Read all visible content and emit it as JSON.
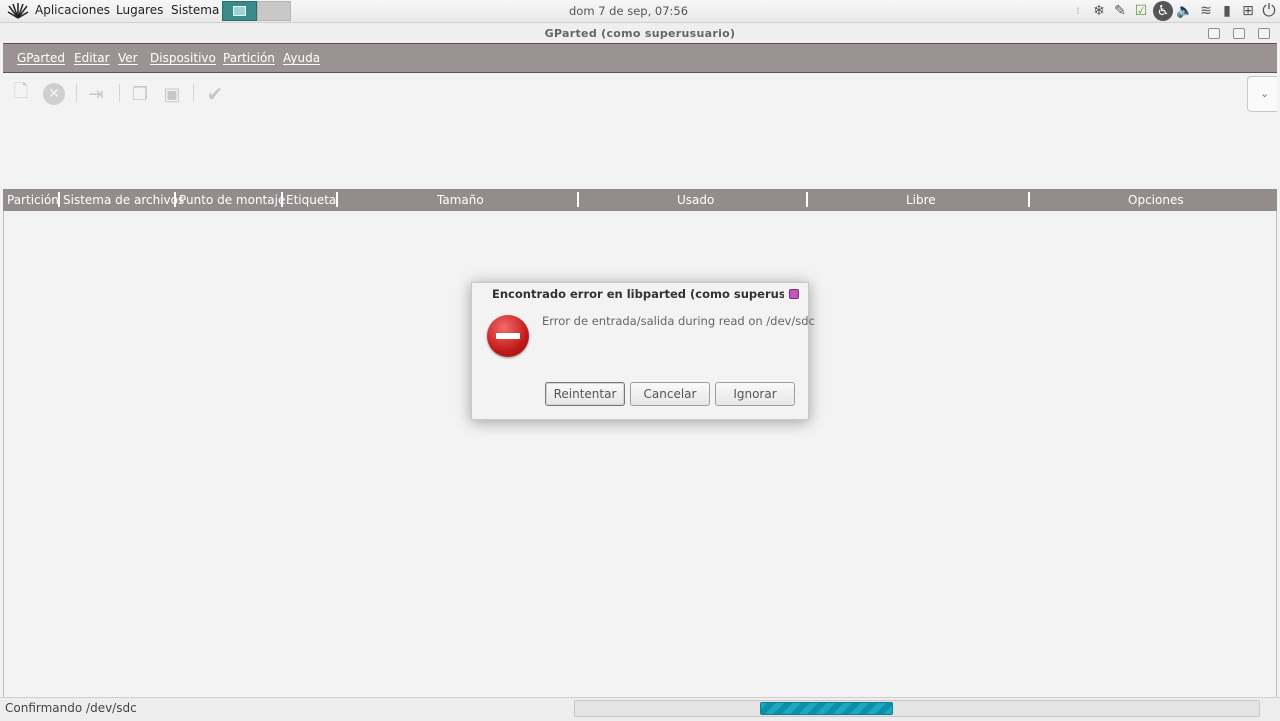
{
  "panel": {
    "menus": [
      "Aplicaciones",
      "Lugares",
      "Sistema"
    ],
    "clock": "dom  7 de sep, 07:56"
  },
  "window": {
    "title": "GParted (como superusuario)"
  },
  "menubar": {
    "items": [
      "GParted",
      "Editar",
      "Ver",
      "Dispositivo",
      "Partición",
      "Ayuda"
    ]
  },
  "toolbar": {
    "icons": [
      "new-partition-icon",
      "delete-icon",
      "resize-move-icon",
      "copy-icon",
      "paste-icon",
      "apply-icon"
    ]
  },
  "table": {
    "columns": [
      "Partición",
      "Sistema de archivos",
      "Punto de montaje",
      "Etiqueta",
      "Tamaño",
      "Usado",
      "Libre",
      "Opciones"
    ]
  },
  "status": {
    "text": "Confirmando /dev/sdc",
    "progress_fraction_start": 0.27,
    "progress_fraction_end": 0.465,
    "progress_color": "#1aa9c2"
  },
  "dialog": {
    "title": "Encontrado error en libparted (como superusuario)",
    "message": "Error de entrada/salida during read on /dev/sdc",
    "buttons": [
      "Reintentar",
      "Cancelar",
      "Ignorar"
    ],
    "icon": "error-icon"
  }
}
